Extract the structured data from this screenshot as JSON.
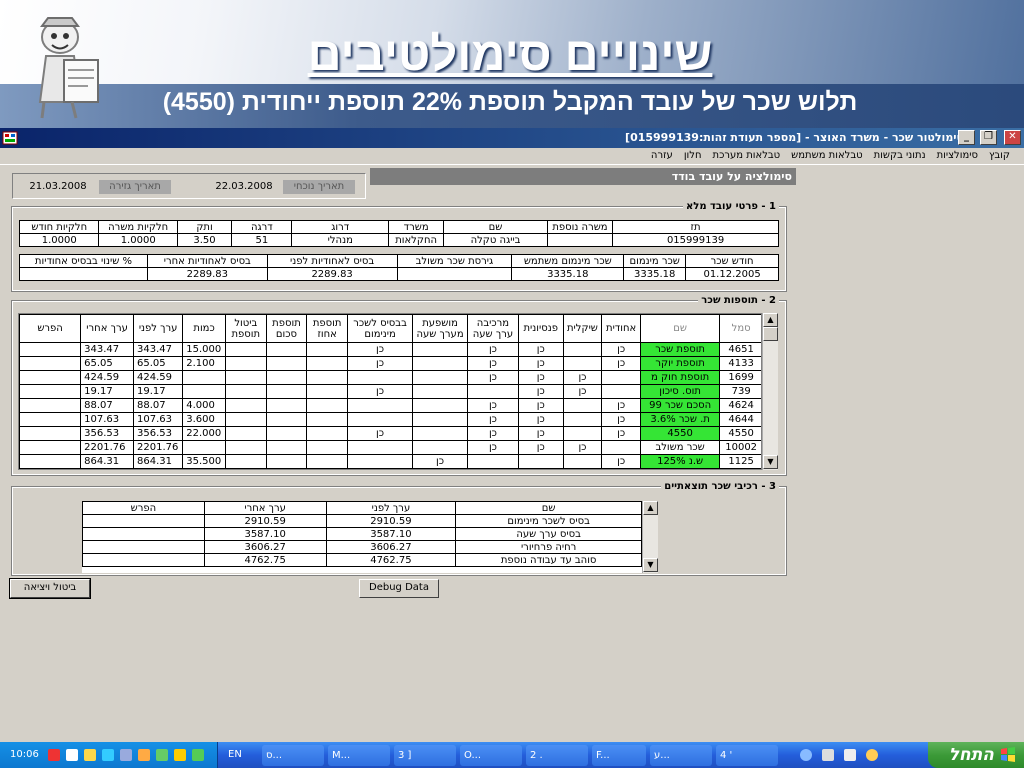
{
  "slide": {
    "title": "שינויים סימולטיבים",
    "subtitle": "תלוש שכר של עובד המקבל תוספת 22% תוספת ייחודית (4550)"
  },
  "window": {
    "title": "סימולטור שכר - משרד האוצר - [מספר תעודת זהות:015999139]",
    "menu": [
      "קובץ",
      "סימולציות",
      "נתוני בקשות",
      "טבלאות משתמש",
      "טבלאות מערכת",
      "חלון",
      "עזרה"
    ]
  },
  "panel": {
    "header": "סימולציה על עובד בודד",
    "date_current_label": "תאריך נוכחי",
    "date_current": "22.03.2008",
    "date_creation_label": "תאריך גזירה",
    "date_creation": "21.03.2008"
  },
  "section1": {
    "legend": "1 - פרטי עובד מלא",
    "headers": [
      "תז",
      "משרה נוספת",
      "שם",
      "משרד",
      "דרוג",
      "דרגה",
      "ותק",
      "חלקיות משרה",
      "חלקיות חודש"
    ],
    "row": [
      "015999139",
      "",
      "בייגה טקלה",
      "החקלאות",
      "מנהלי",
      "51",
      "3.50",
      "1.0000",
      "1.0000"
    ],
    "headers2": [
      "חודש שכר",
      "שכר מינמום",
      "שכר מינמום משתמש",
      "גירסת שכר משולב",
      "בסיס לאחודיות לפני",
      "בסיס לאחודיות אחרי",
      "% שינוי בבסיס אחודיות"
    ],
    "row2": [
      "01.12.2005",
      "3335.18",
      "3335.18",
      "",
      "2289.83",
      "2289.83",
      ""
    ]
  },
  "section2": {
    "legend": "2 - תוספות שכר",
    "headers": [
      "סמל",
      "שם",
      "אחודית",
      "שיקלית",
      "פנסיונית",
      "מרכיבה ערך שעה",
      "מושפעת מערך שעה",
      "בבסיס לשכר מינימום",
      "תוספת אחוז",
      "תוספת סכום",
      "ביטול תוספת",
      "כמות",
      "ערך לפני",
      "ערך אחרי",
      "הפרש"
    ],
    "rows": [
      {
        "code": "4651",
        "name": "תוספת שכר",
        "ahud": "כן",
        "shik": "",
        "pens": "כן",
        "merk": "כן",
        "mushp": "",
        "minim": "כן",
        "ahuz": "",
        "skum": "",
        "bitul": "",
        "kamut": "15.000",
        "before": "343.47",
        "after": "343.47",
        "diff": "",
        "green": true
      },
      {
        "code": "4133",
        "name": "תוספת יוקר",
        "ahud": "כן",
        "shik": "",
        "pens": "כן",
        "merk": "כן",
        "mushp": "",
        "minim": "כן",
        "ahuz": "",
        "skum": "",
        "bitul": "",
        "kamut": "2.100",
        "before": "65.05",
        "after": "65.05",
        "diff": "",
        "green": true
      },
      {
        "code": "1699",
        "name": "תוספת חוק מ",
        "ahud": "",
        "shik": "כן",
        "pens": "כן",
        "merk": "כן",
        "mushp": "",
        "minim": "",
        "ahuz": "",
        "skum": "",
        "bitul": "",
        "kamut": "",
        "before": "424.59",
        "after": "424.59",
        "diff": "",
        "green": true
      },
      {
        "code": "739",
        "name": "תוס. סיכון",
        "ahud": "",
        "shik": "כן",
        "pens": "כן",
        "merk": "",
        "mushp": "",
        "minim": "כן",
        "ahuz": "",
        "skum": "",
        "bitul": "",
        "kamut": "",
        "before": "19.17",
        "after": "19.17",
        "diff": "",
        "green": true
      },
      {
        "code": "4624",
        "name": "הסכם שכר 99",
        "ahud": "כן",
        "shik": "",
        "pens": "כן",
        "merk": "כן",
        "mushp": "",
        "minim": "",
        "ahuz": "",
        "skum": "",
        "bitul": "",
        "kamut": "4.000",
        "before": "88.07",
        "after": "88.07",
        "diff": "",
        "green": true
      },
      {
        "code": "4644",
        "name": "ת. שכר 3.6%",
        "ahud": "כן",
        "shik": "",
        "pens": "כן",
        "merk": "כן",
        "mushp": "",
        "minim": "",
        "ahuz": "",
        "skum": "",
        "bitul": "",
        "kamut": "3.600",
        "before": "107.63",
        "after": "107.63",
        "diff": "",
        "green": true
      },
      {
        "code": "4550",
        "name": "4550",
        "ahud": "כן",
        "shik": "",
        "pens": "כן",
        "merk": "כן",
        "mushp": "",
        "minim": "כן",
        "ahuz": "",
        "skum": "",
        "bitul": "",
        "kamut": "22.000",
        "before": "356.53",
        "after": "356.53",
        "diff": "",
        "green": true
      },
      {
        "code": "10002",
        "name": "שכר משולב",
        "ahud": "",
        "shik": "כן",
        "pens": "כן",
        "merk": "כן",
        "mushp": "",
        "minim": "",
        "ahuz": "",
        "skum": "",
        "bitul": "",
        "kamut": "",
        "before": "2201.76",
        "after": "2201.76",
        "diff": "",
        "green": false
      },
      {
        "code": "1125",
        "name": "ש.נ 125%",
        "ahud": "כן",
        "shik": "",
        "pens": "",
        "merk": "",
        "mushp": "כן",
        "minim": "",
        "ahuz": "",
        "skum": "",
        "bitul": "",
        "kamut": "35.500",
        "before": "864.31",
        "after": "864.31",
        "diff": "",
        "green": true
      }
    ]
  },
  "section3": {
    "legend": "3 - רכיבי שכר תוצאתיים",
    "headers": [
      "שם",
      "ערך לפני",
      "ערך אחרי",
      "הפרש"
    ],
    "rows": [
      {
        "name": "בסיס לשכר מינימום",
        "before": "2910.59",
        "after": "2910.59",
        "diff": ""
      },
      {
        "name": "בסיס ערך שעה",
        "before": "3587.10",
        "after": "3587.10",
        "diff": ""
      },
      {
        "name": "רחיה פרחיורי",
        "before": "3606.27",
        "after": "3606.27",
        "diff": ""
      },
      {
        "name": "סוהב עד עבודה נוספת",
        "before": "4762.75",
        "after": "4762.75",
        "diff": ""
      }
    ]
  },
  "buttons": {
    "cancel_exit": "ביטול ויציאה",
    "debug": "Debug Data"
  },
  "taskbar": {
    "start": "התחל",
    "clock": "10:06",
    "lang": "EN",
    "items": [
      "ס...",
      "M...",
      "3 ]",
      "O...",
      "2 .",
      "F...",
      "ע...",
      "4 '"
    ]
  },
  "colors": {
    "highlight_green": "#35e535",
    "titlebar": "#0a246a",
    "window_bg": "#d4d0c8"
  }
}
